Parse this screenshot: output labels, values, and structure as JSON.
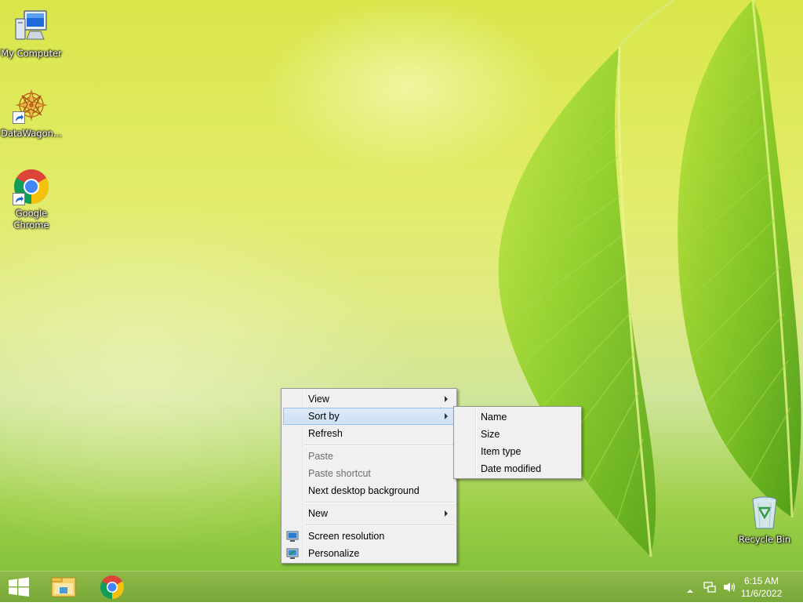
{
  "desktop": {
    "icons": [
      {
        "label": "My Computer"
      },
      {
        "label": "DataWagon..."
      },
      {
        "label": "Google\nChrome"
      },
      {
        "label": "Recycle Bin"
      }
    ]
  },
  "context_menu": {
    "items": {
      "view": "View",
      "sort_by": "Sort by",
      "refresh": "Refresh",
      "paste": "Paste",
      "paste_shortcut": "Paste shortcut",
      "next_background": "Next desktop background",
      "new": "New",
      "screen_resolution": "Screen resolution",
      "personalize": "Personalize"
    },
    "hovered": "Sort by"
  },
  "sort_submenu": {
    "items": {
      "name": "Name",
      "size": "Size",
      "item_type": "Item type",
      "date_modified": "Date modified"
    }
  },
  "taskbar": {
    "clock": {
      "time": "6:15 AM",
      "date": "11/6/2022"
    }
  },
  "colors": {
    "accent_taskbar": "#7fb03e",
    "menu_background": "#f0f0f0",
    "menu_hover": "#cfe1f5"
  }
}
